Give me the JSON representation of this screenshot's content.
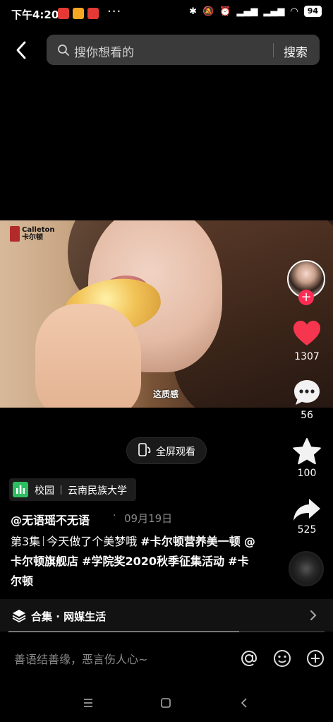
{
  "status_bar": {
    "time": "下午4:20",
    "battery": "94",
    "app_colors": [
      "#e53935",
      "#f5a623",
      "#e53935"
    ]
  },
  "search": {
    "placeholder": "搜你想看的",
    "button": "搜索"
  },
  "video": {
    "subtitle": "这质感",
    "brand_logo": "Calleton 卡尔顿"
  },
  "side_actions": {
    "likes": "1307",
    "comments": "56",
    "favorites": "100",
    "shares": "525"
  },
  "fullscreen_label": "全屏观看",
  "location_tag": {
    "type": "校园",
    "name": "云南民族大学"
  },
  "post": {
    "author": "@无语瑶不无语",
    "dot": "·",
    "date": "09月19日",
    "episode": "第3集",
    "desc_text": "今天做了个美梦哦",
    "hashtag1": "#卡尔顿营养美一顿",
    "mention": "@卡尔顿旗舰店",
    "hashtag2": "#学院奖2020秋季征集活动",
    "hashtag3": "#卡尔顿"
  },
  "collection": {
    "label": "合集 · 网媒生活",
    "progress": 0.73
  },
  "comment_input": {
    "placeholder": "善语结善缘，恶言伤人心~"
  },
  "colors": {
    "like_red": "#fe2c55",
    "heart": "#f5364e"
  }
}
